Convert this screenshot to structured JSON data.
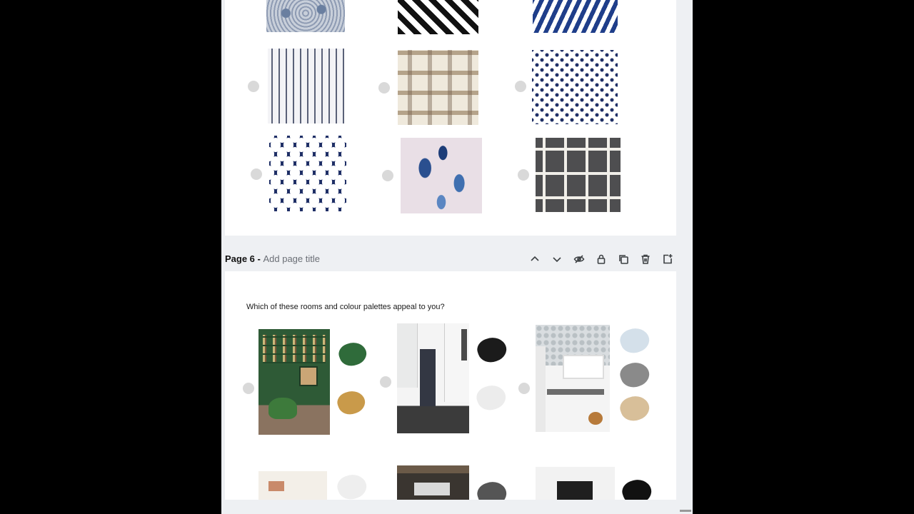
{
  "page6": {
    "label": "Page 6 - ",
    "title_placeholder": "Add page title",
    "question": "Which of these rooms and colour palettes appeal to  you?"
  },
  "header_icons": [
    "chevron-up-icon",
    "chevron-down-icon",
    "hide-icon",
    "lock-icon",
    "duplicate-icon",
    "trash-icon",
    "add-page-icon"
  ],
  "colors": {
    "navy": "#1f2f66",
    "paint_green": "#2f6b3a",
    "paint_ochre": "#c99a4a",
    "paint_black": "#1b1b1b",
    "paint_offwhite": "#ececec",
    "paint_pale_blue": "#d4e0ea",
    "paint_grey": "#8a8a8a",
    "paint_beige": "#d8bf99"
  }
}
